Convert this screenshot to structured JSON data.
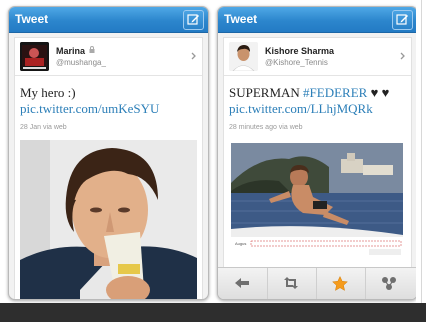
{
  "left_panel": {
    "header_title": "Tweet",
    "user": {
      "name": "Marina",
      "handle": "@mushanga_"
    },
    "tweet": {
      "text": "My hero :) ",
      "link": "pic.twitter.com/umKeSYU",
      "meta": "28 Jan via web"
    }
  },
  "right_panel": {
    "header_title": "Tweet",
    "user": {
      "name": "Kishore Sharma",
      "handle": "@Kishore_Tennis"
    },
    "tweet": {
      "text": "SUPERMAN ",
      "hashtag": "#FEDERER",
      "hearts": " ♥ ♥ ",
      "link": "pic.twitter.com/LLhjMQRk",
      "meta": "28 minutes ago via web"
    },
    "actions": [
      {
        "icon": "reply-icon"
      },
      {
        "icon": "retweet-icon"
      },
      {
        "icon": "star-icon",
        "color": "#f59b1c"
      },
      {
        "icon": "more-icon"
      }
    ]
  }
}
